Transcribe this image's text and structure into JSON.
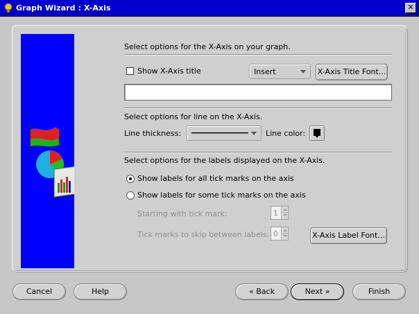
{
  "window": {
    "title": "Graph Wizard : X-Axis",
    "close_label": "✕"
  },
  "xaxis_section": {
    "heading": "Select options for the X-Axis on your graph.",
    "show_title_label": "Show X-Axis title",
    "show_title_checked": false,
    "position_select": {
      "value": "Insert"
    },
    "title_font_button": "X-Axis Title Font...",
    "title_input": {
      "value": "",
      "placeholder": ""
    }
  },
  "line_section": {
    "heading": "Select options for line on the X-Axis.",
    "thickness_label": "Line thickness:",
    "color_label": "Line color:",
    "line_color": "#000000"
  },
  "labels_section": {
    "heading": "Select options for the labels displayed on the X-Axis.",
    "radio_all_label": "Show labels for all tick marks on the axis",
    "radio_some_label": "Show labels for some tick marks on the axis",
    "selected": "all",
    "start_tick_label": "Starting with tick mark:",
    "start_tick_value": "1",
    "skip_label": "Tick marks to skip between labels:",
    "skip_value": "0",
    "label_font_button": "X-Axis Label Font..."
  },
  "footer": {
    "cancel": "Cancel",
    "help": "Help",
    "back": "Back",
    "next": "Next",
    "finish": "Finish"
  },
  "colors": {
    "title_bar": "#0000cc",
    "side_image": "#0000ff",
    "dialog_bg": "#c7c7c7"
  },
  "icons": {
    "title": "graph-wizard-bulb-icon",
    "side": "graph-wizard-illustration"
  }
}
